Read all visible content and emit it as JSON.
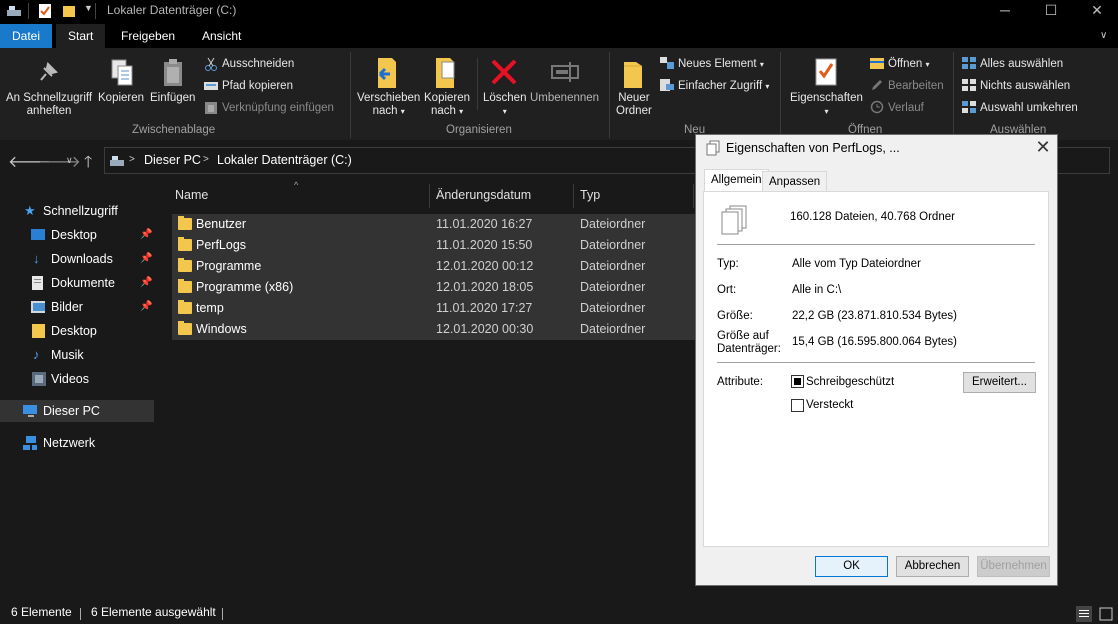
{
  "window": {
    "title": "Lokaler Datenträger (C:)"
  },
  "tabs": [
    {
      "label": "Datei"
    },
    {
      "label": "Start"
    },
    {
      "label": "Freigeben"
    },
    {
      "label": "Ansicht"
    }
  ],
  "ribbon": {
    "pin": "An Schnellzugriff\nanheften",
    "pin1": "An Schnellzugriff",
    "pin2": "anheften",
    "copy": "Kopieren",
    "paste": "Einfügen",
    "cut": "Ausschneiden",
    "copy_path": "Pfad kopieren",
    "paste_shortcut": "Verknüpfung einfügen",
    "group_clipboard": "Zwischenablage",
    "move1": "Verschieben",
    "move2": "nach",
    "copyto1": "Kopieren",
    "copyto2": "nach",
    "delete": "Löschen",
    "rename": "Umbenennen",
    "group_organize": "Organisieren",
    "newfolder1": "Neuer",
    "newfolder2": "Ordner",
    "new_item": "Neues Element",
    "easy_access": "Einfacher Zugriff",
    "group_new": "Neu",
    "properties": "Eigenschaften",
    "open": "Öffnen",
    "edit": "Bearbeiten",
    "history": "Verlauf",
    "group_open": "Öffnen",
    "select_all": "Alles auswählen",
    "select_none": "Nichts auswählen",
    "invert": "Auswahl umkehren",
    "group_select": "Auswählen"
  },
  "address": {
    "seg1": "Dieser PC",
    "seg2": "Lokaler Datenträger (C:)"
  },
  "nav": {
    "quick": "Schnellzugriff",
    "items": [
      {
        "label": "Desktop"
      },
      {
        "label": "Downloads"
      },
      {
        "label": "Dokumente"
      },
      {
        "label": "Bilder"
      },
      {
        "label": "Desktop"
      },
      {
        "label": "Musik"
      },
      {
        "label": "Videos"
      }
    ],
    "thispc": "Dieser PC",
    "network": "Netzwerk"
  },
  "columns": {
    "name": "Name",
    "date": "Änderungsdatum",
    "type": "Typ"
  },
  "files": [
    {
      "name": "Benutzer",
      "date": "11.01.2020 16:27",
      "type": "Dateiordner"
    },
    {
      "name": "PerfLogs",
      "date": "11.01.2020 15:50",
      "type": "Dateiordner"
    },
    {
      "name": "Programme",
      "date": "12.01.2020 00:12",
      "type": "Dateiordner"
    },
    {
      "name": "Programme (x86)",
      "date": "12.01.2020 18:05",
      "type": "Dateiordner"
    },
    {
      "name": "temp",
      "date": "11.01.2020 17:27",
      "type": "Dateiordner"
    },
    {
      "name": "Windows",
      "date": "12.01.2020 00:30",
      "type": "Dateiordner"
    }
  ],
  "status": {
    "count": "6 Elemente",
    "selected": "6 Elemente ausgewählt"
  },
  "dialog": {
    "title": "Eigenschaften von PerfLogs, ...",
    "tab_general": "Allgemein",
    "tab_custom": "Anpassen",
    "summary": "160.128 Dateien, 40.768 Ordner",
    "type_label": "Typ:",
    "type_value": "Alle vom Typ Dateiordner",
    "location_label": "Ort:",
    "location_value": "Alle in C:\\",
    "size_label": "Größe:",
    "size_value": "22,2 GB (23.871.810.534 Bytes)",
    "disk_label1": "Größe auf",
    "disk_label2": "Datenträger:",
    "disk_value": "15,4 GB (16.595.800.064 Bytes)",
    "attr_label": "Attribute:",
    "readonly": "Schreibgeschützt",
    "hidden": "Versteckt",
    "advanced": "Erweitert...",
    "ok": "OK",
    "cancel": "Abbrechen",
    "apply": "Übernehmen"
  }
}
